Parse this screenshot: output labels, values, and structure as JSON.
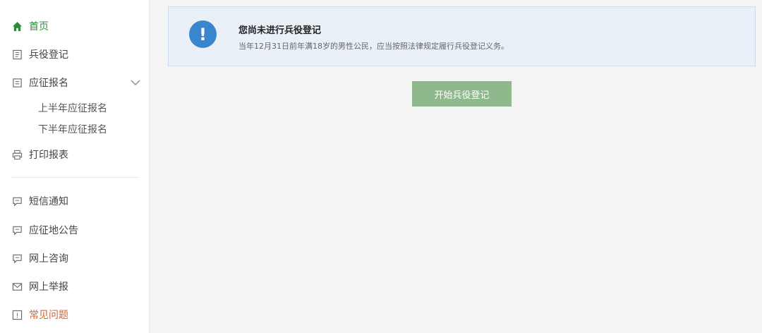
{
  "sidebar": {
    "items": [
      {
        "label": "首页",
        "icon": "home-icon"
      },
      {
        "label": "兵役登记",
        "icon": "form-icon"
      },
      {
        "label": "应征报名",
        "icon": "document-icon"
      },
      {
        "label": "打印报表",
        "icon": "printer-icon"
      },
      {
        "label": "短信通知",
        "icon": "message-icon"
      },
      {
        "label": "应征地公告",
        "icon": "message-icon"
      },
      {
        "label": "网上咨询",
        "icon": "message-icon"
      },
      {
        "label": "网上举报",
        "icon": "mail-icon"
      },
      {
        "label": "常见问题",
        "icon": "help-icon"
      }
    ],
    "sub_items": [
      {
        "label": "上半年应征报名"
      },
      {
        "label": "下半年应征报名"
      }
    ]
  },
  "notice": {
    "title": "您尚未进行兵役登记",
    "description": "当年12月31日前年满18岁的男性公民，应当按照法律规定履行兵役登记义务。",
    "icon": "exclamation-icon"
  },
  "actions": {
    "start_label": "开始兵役登记"
  },
  "colors": {
    "accent_green": "#2e8b3e",
    "button_green": "#8fb98c",
    "notice_bg": "#e9f0f8",
    "notice_icon": "#3a86cc",
    "highlight_orange": "#d9632b"
  }
}
